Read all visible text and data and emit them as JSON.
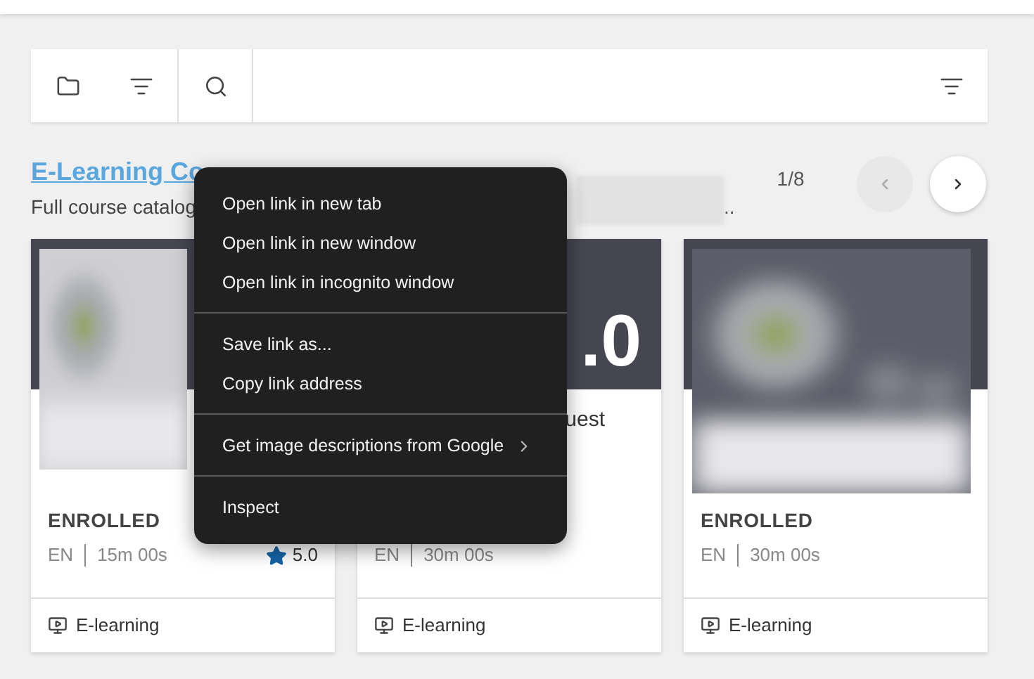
{
  "section": {
    "title": "E-Learning Co",
    "subtitle": "Full course catalog",
    "subtitle_end": "..",
    "pager": "1/8",
    "prev_disabled": true
  },
  "cards": [
    {
      "kind": "image_left",
      "status": "ENROLLED",
      "language": "EN",
      "duration": "15m 00s",
      "rating": "5.0",
      "type": "E-learning"
    },
    {
      "kind": "banner",
      "banner_text": ".0",
      "title_lines": [
        "uest"
      ],
      "language": "EN",
      "duration": "30m 00s",
      "type": "E-learning"
    },
    {
      "kind": "image_full",
      "status": "ENROLLED",
      "language": "EN",
      "duration": "30m 00s",
      "type": "E-learning"
    }
  ],
  "context_menu": {
    "groups": [
      [
        "Open link in new tab",
        "Open link in new window",
        "Open link in incognito window"
      ],
      [
        "Save link as...",
        "Copy link address"
      ],
      [
        {
          "label": "Get image descriptions from Google",
          "submenu": true
        }
      ],
      [
        "Inspect"
      ]
    ]
  }
}
